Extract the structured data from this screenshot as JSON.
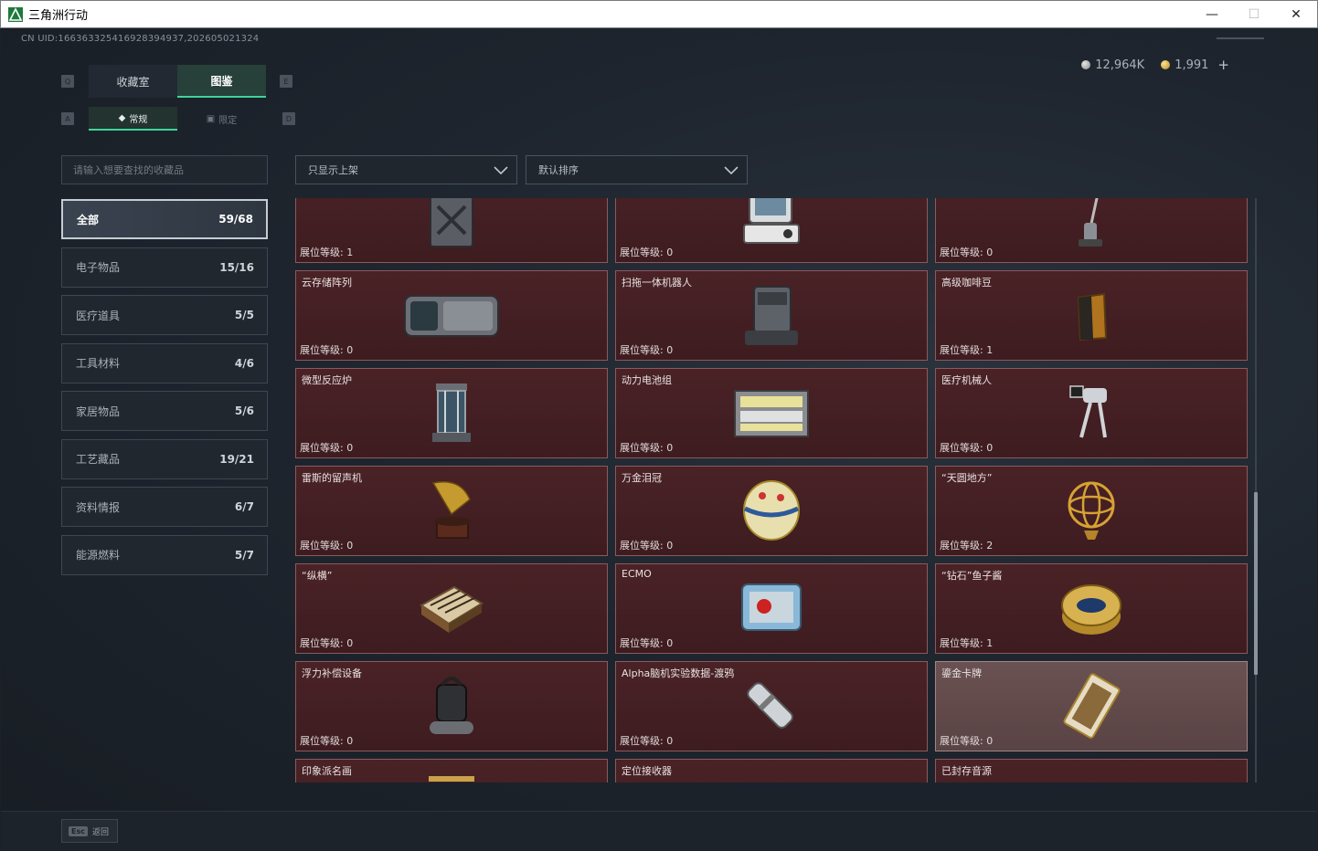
{
  "window": {
    "title": "三角洲行动"
  },
  "uid": "CN UID:166363325416928394937,202605021324",
  "currency": {
    "silver": "12,964K",
    "gold": "1,991",
    "add_label": "+"
  },
  "hotkeys": {
    "q": "Q",
    "e": "E",
    "a": "A",
    "d": "D"
  },
  "main_tabs": [
    {
      "label": "收藏室"
    },
    {
      "label": "图鉴"
    }
  ],
  "sub_tabs": [
    {
      "label": "常规"
    },
    {
      "label": "限定"
    }
  ],
  "search": {
    "placeholder": "请输入想要查找的收藏品"
  },
  "filters": {
    "shelf": "只显示上架",
    "sort": "默认排序"
  },
  "categories": [
    {
      "label": "全部",
      "count": "59/68"
    },
    {
      "label": "电子物品",
      "count": "15/16"
    },
    {
      "label": "医疗道具",
      "count": "5/5"
    },
    {
      "label": "工具材料",
      "count": "4/6"
    },
    {
      "label": "家居物品",
      "count": "5/6"
    },
    {
      "label": "工艺藏品",
      "count": "19/21"
    },
    {
      "label": "资料情报",
      "count": "6/7"
    },
    {
      "label": "能源燃料",
      "count": "5/7"
    }
  ],
  "items": [
    {
      "name": "",
      "level": "展位等级: 1",
      "icon": "fuel-can"
    },
    {
      "name": "",
      "level": "展位等级: 0",
      "icon": "medical-device"
    },
    {
      "name": "",
      "level": "展位等级: 0",
      "icon": "floor-cleaner"
    },
    {
      "name": "云存储阵列",
      "level": "展位等级: 0",
      "icon": "storage-array"
    },
    {
      "name": "扫拖一体机器人",
      "level": "展位等级: 0",
      "icon": "mop-robot"
    },
    {
      "name": "高级咖啡豆",
      "level": "展位等级: 1",
      "icon": "coffee-bag"
    },
    {
      "name": "微型反应炉",
      "level": "展位等级: 0",
      "icon": "reactor"
    },
    {
      "name": "动力电池组",
      "level": "展位等级: 0",
      "icon": "battery-pack"
    },
    {
      "name": "医疗机械人",
      "level": "展位等级: 0",
      "icon": "medical-robot"
    },
    {
      "name": "雷斯的留声机",
      "level": "展位等级: 0",
      "icon": "gramophone"
    },
    {
      "name": "万金泪冠",
      "level": "展位等级: 0",
      "icon": "jeweled-egg"
    },
    {
      "name": "“天圆地方”",
      "level": "展位等级: 2",
      "icon": "armillary-sphere"
    },
    {
      "name": "“纵横”",
      "level": "展位等级: 0",
      "icon": "chess-board"
    },
    {
      "name": "ECMO",
      "level": "展位等级: 0",
      "icon": "ecmo"
    },
    {
      "name": "“钻石”鱼子酱",
      "level": "展位等级: 1",
      "icon": "caviar-tin"
    },
    {
      "name": "浮力补偿设备",
      "level": "展位等级: 0",
      "icon": "buoyancy-device"
    },
    {
      "name": "Alpha脑机实验数据-渡鸦",
      "level": "展位等级: 0",
      "icon": "data-drive"
    },
    {
      "name": "鎏金卡牌",
      "level": "展位等级: 0",
      "icon": "gilded-card"
    },
    {
      "name": "印象派名画",
      "level": "",
      "icon": "painting"
    },
    {
      "name": "定位接收器",
      "level": "",
      "icon": "receiver"
    },
    {
      "name": "已封存音源",
      "level": "",
      "icon": "sealed-audio"
    }
  ],
  "bottom": {
    "esc_key": "Esc",
    "back_label": "返回"
  },
  "colors": {
    "accent": "#3fd49a",
    "card_bg": "#42202a",
    "card_border": "#8a5a5e"
  }
}
